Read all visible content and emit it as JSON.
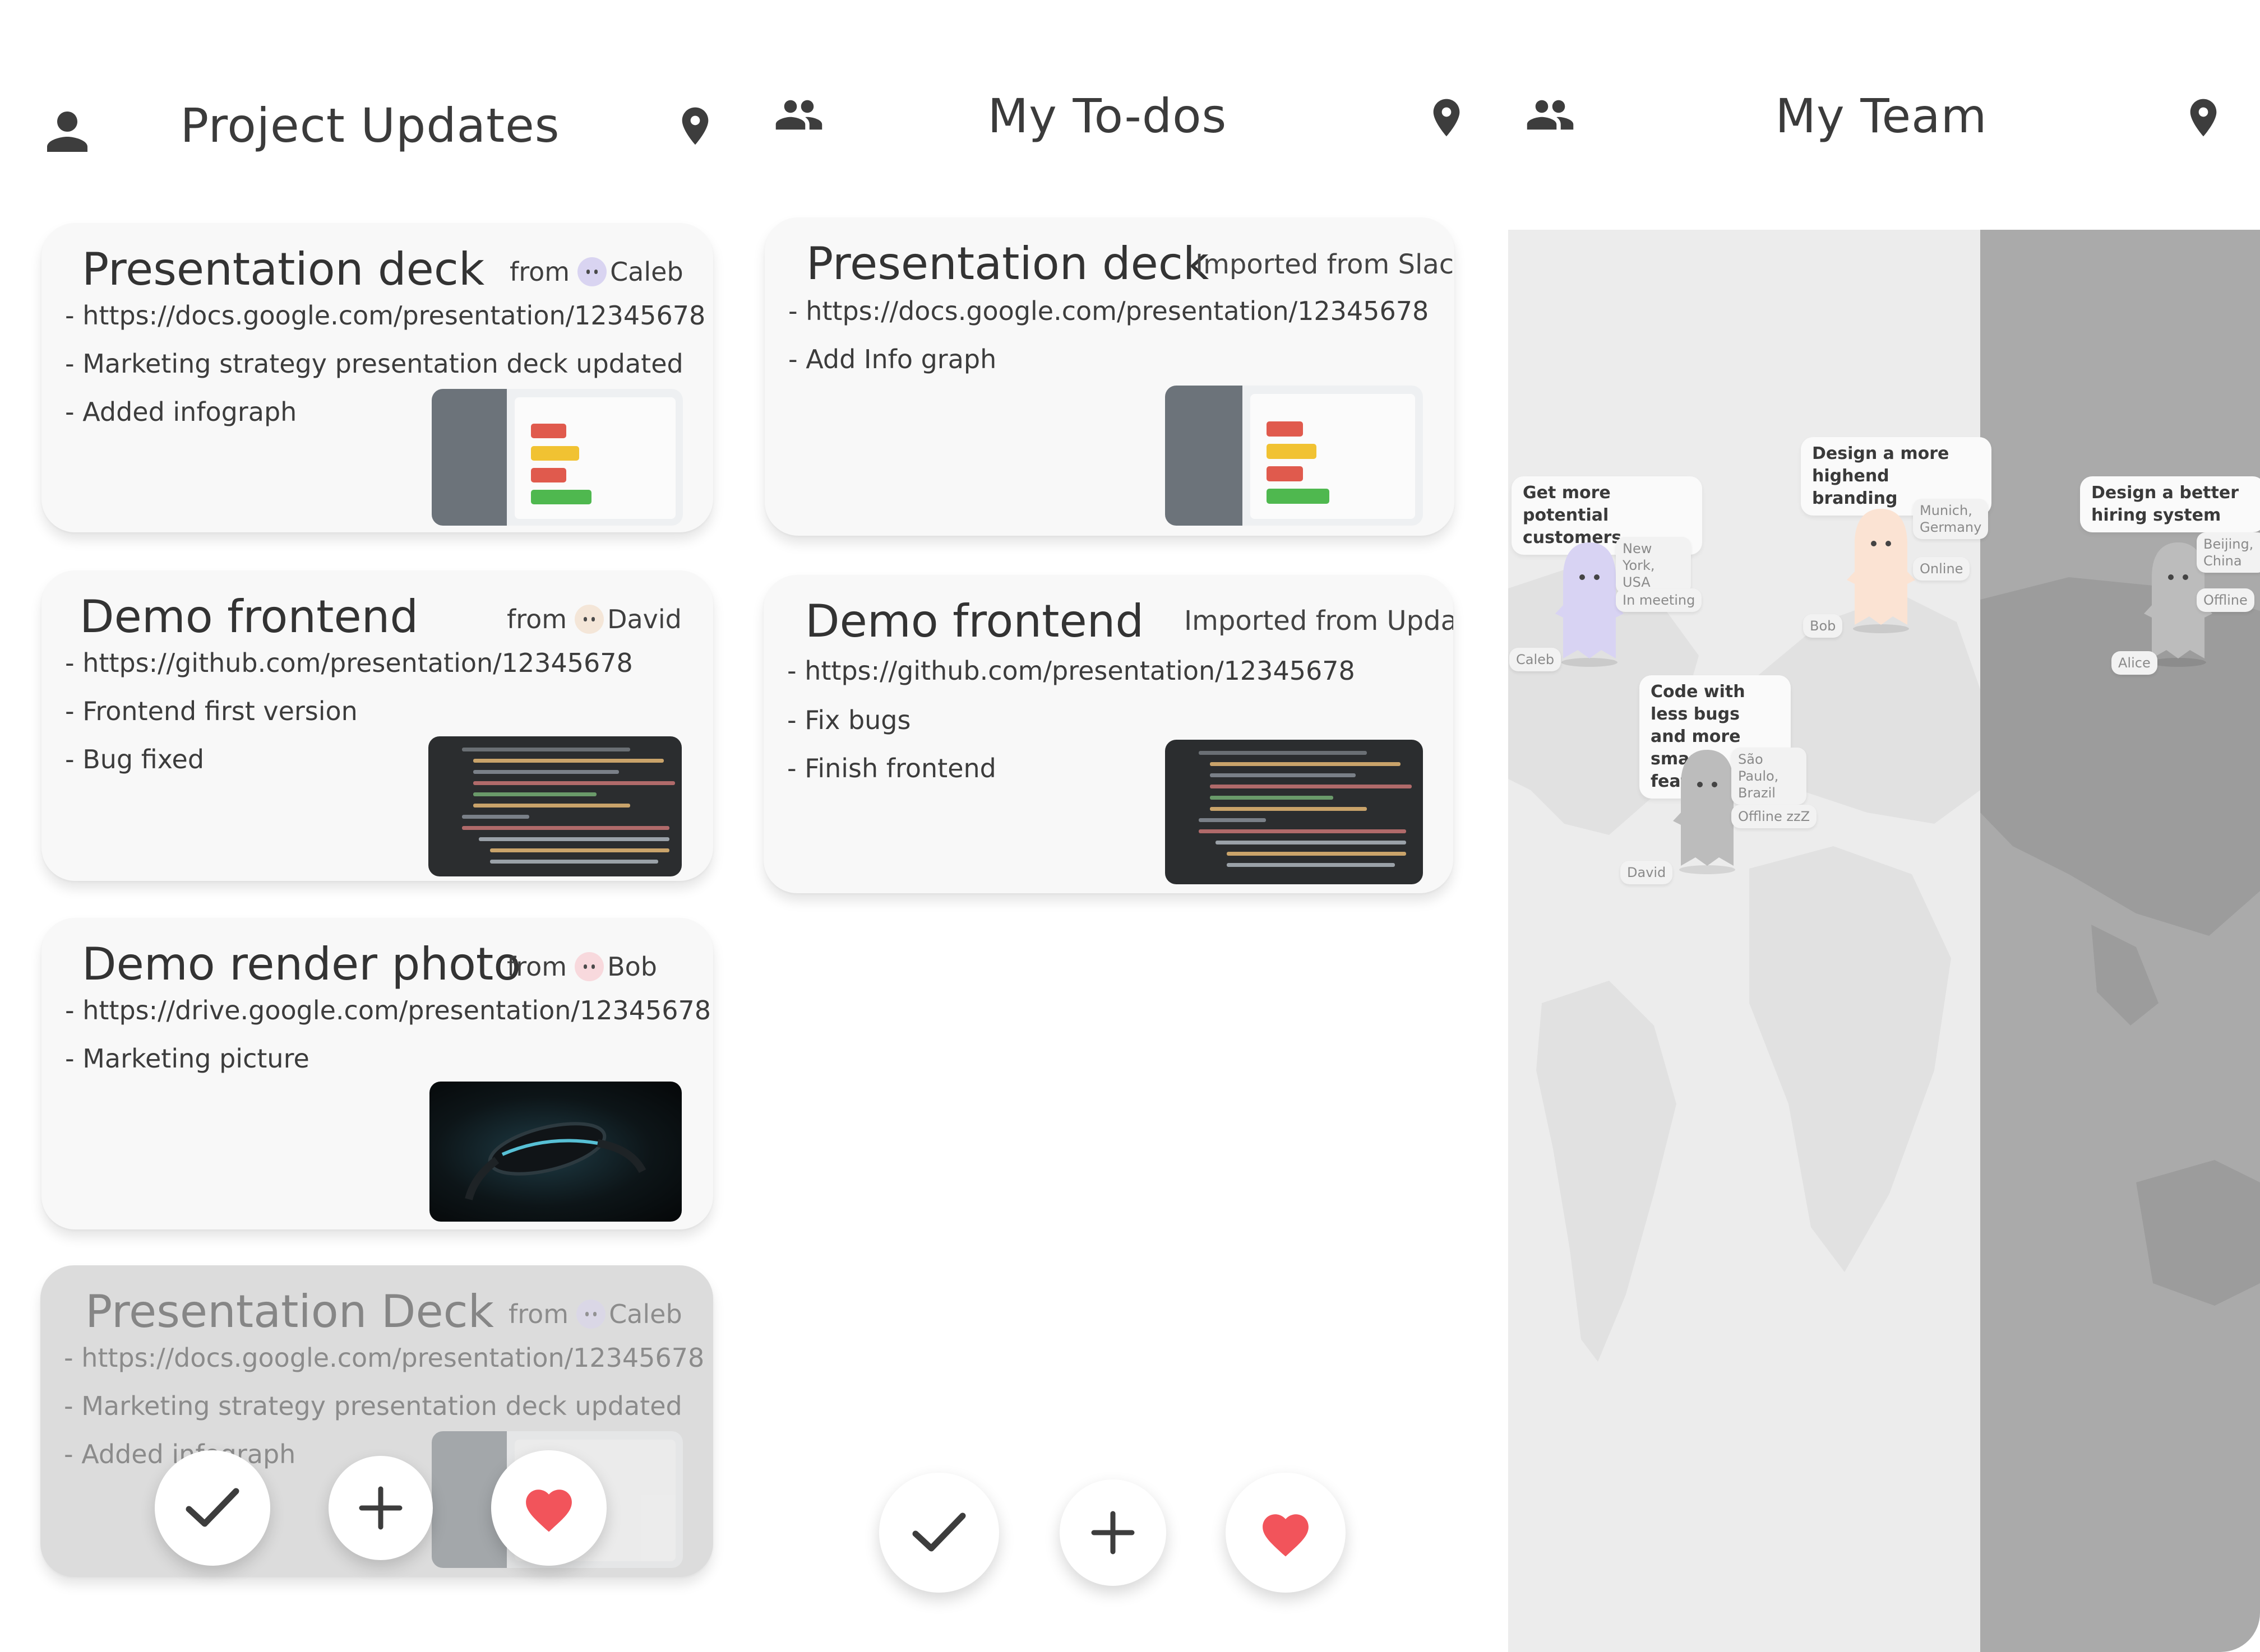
{
  "updates": {
    "title": "Project Updates",
    "icon_left": "person-icon",
    "icon_right": "location-pin-icon",
    "cards": [
      {
        "title": "Presentation deck",
        "from_label": "from",
        "from_name": "Caleb",
        "avatar_color": "#d9d4f1",
        "lines": [
          "- https://docs.google.com/presentation/12345678",
          "- Marketing strategy presentation deck updated",
          "- Added infograph"
        ],
        "thumb": "deck"
      },
      {
        "title": "Demo frontend",
        "from_label": "from",
        "from_name": "David",
        "avatar_color": "#f4e6d8",
        "lines": [
          "- https://github.com/presentation/12345678",
          "- Frontend first version",
          "- Bug fixed"
        ],
        "thumb": "code"
      },
      {
        "title": "Demo render photo",
        "from_label": "from",
        "from_name": "Bob",
        "avatar_color": "#f8d9dd",
        "lines": [
          "- https://drive.google.com/presentation/12345678",
          "- Marketing picture"
        ],
        "thumb": "photo"
      },
      {
        "title": "Presentation Deck",
        "from_label": "from",
        "from_name": "Caleb",
        "avatar_color": "#d9d4f1",
        "lines": [
          "- https://docs.google.com/presentation/12345678",
          "- Marketing strategy presentation deck updated",
          "- Added infograph"
        ],
        "thumb": "deck"
      }
    ]
  },
  "todos": {
    "title": "My To-dos",
    "icon_left": "group-icon",
    "icon_right": "location-pin-icon",
    "cards": [
      {
        "title": "Presentation deck",
        "source": "Imported from Slack",
        "lines": [
          "- https://docs.google.com/presentation/12345678",
          "- Add Info graph"
        ],
        "thumb": "deck"
      },
      {
        "title": "Demo frontend",
        "source": "Imported from Update",
        "lines": [
          "- https://github.com/presentation/12345678",
          "- Fix bugs",
          "- Finish frontend"
        ],
        "thumb": "code"
      }
    ]
  },
  "team": {
    "title": "My Team",
    "icon_left": "group-icon",
    "icon_right": "location-pin-icon",
    "goals": [
      "Get more potential customers",
      "Design a more highend branding",
      "Code with less bugs and more smart features",
      "Design a better hiring system"
    ],
    "members": [
      {
        "name": "Caleb",
        "location": "New York, USA",
        "status": "In meeting",
        "color": "#d8d3f3"
      },
      {
        "name": "Bob",
        "location": "Munich, Germany",
        "status": "Online",
        "color": "#fbe3d3"
      },
      {
        "name": "David",
        "location": "São Paulo, Brazil",
        "status": "Offline zzZ",
        "color": "#bcbcbc"
      },
      {
        "name": "Alice",
        "location": "Beijing, China",
        "status": "Offline",
        "color": "#bcbcbc"
      }
    ]
  },
  "actions": {
    "complete": "check-icon",
    "add": "plus-icon",
    "like": "heart-icon",
    "heart_color": "#f2545b"
  }
}
